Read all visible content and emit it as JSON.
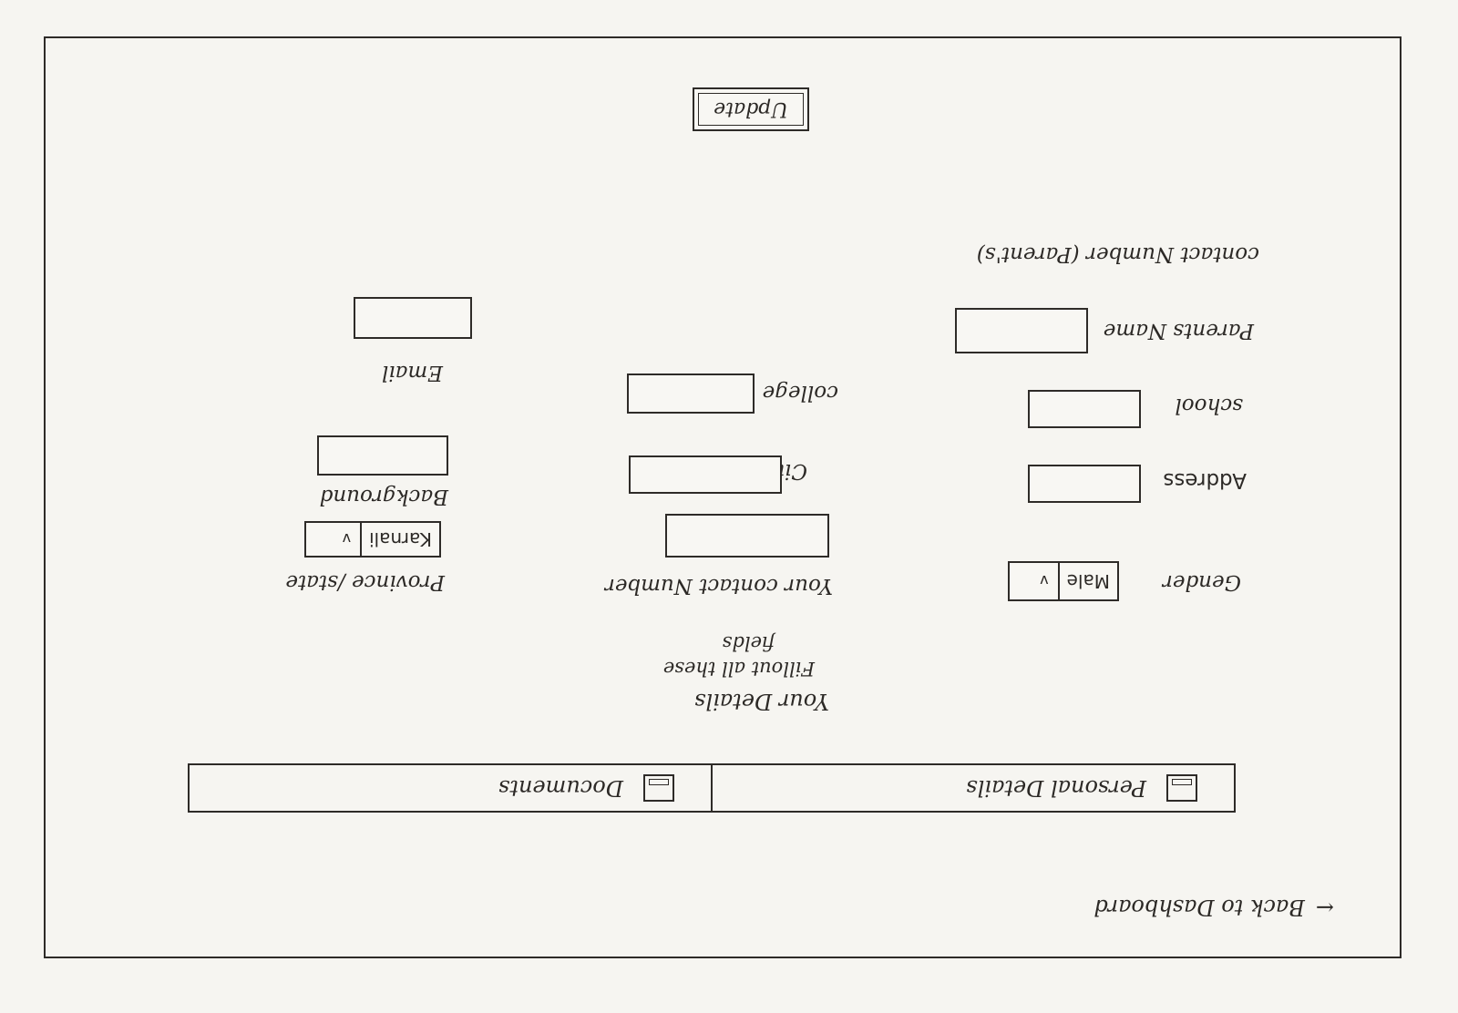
{
  "nav": {
    "back_arrow": "←",
    "back_label": "Back to Dashboard"
  },
  "tabs": [
    {
      "label": "Personal Details",
      "icon": "document-icon"
    },
    {
      "label": "Documents",
      "icon": "document-icon"
    }
  ],
  "intro": {
    "title": "Your Details",
    "subtitle_line1": "Fillout all these",
    "subtitle_line2": "fields"
  },
  "fields": {
    "gender_label": "Gender",
    "gender_value": "Male",
    "address_label": "Address",
    "school_label": "school",
    "parents_name_label": "Parents Name",
    "parents_contact_label": "contact Number (Parent's)",
    "contact_label": "Your contact Number",
    "city_label": "City",
    "college_label": "college",
    "province_label": "Province /state",
    "province_value": "Karnali",
    "background_label": "Background",
    "email_label": "Email"
  },
  "actions": {
    "update_label": "Update"
  },
  "icons": {
    "chevron": "v"
  }
}
